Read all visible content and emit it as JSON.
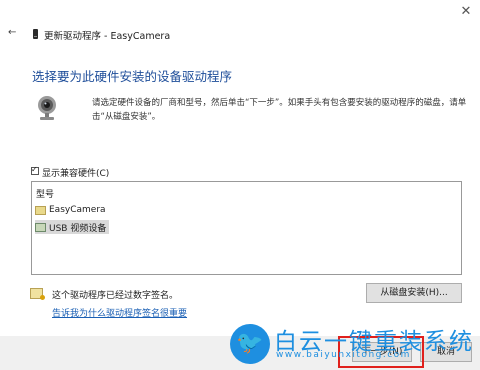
{
  "window": {
    "title": "更新驱动程序 - EasyCamera",
    "close_glyph": "✕",
    "back_glyph": "←"
  },
  "main": {
    "heading": "选择要为此硬件安装的设备驱动程序",
    "instruction": "请选定硬件设备的厂商和型号，然后单击“下一步”。如果手头有包含要安装的驱动程序的磁盘，请单击“从磁盘安装”。",
    "compat_label": "显示兼容硬件(C)",
    "compat_checked": true
  },
  "model_list": {
    "header": "型号",
    "items": [
      {
        "label": "EasyCamera",
        "selected": false
      },
      {
        "label": "USB 视频设备",
        "selected": true
      }
    ]
  },
  "signature": {
    "text": "这个驱动程序已经过数字签名。",
    "link": "告诉我为什么驱动程序签名很重要"
  },
  "buttons": {
    "have_disk": "从磁盘安装(H)...",
    "next": "下一步(N)",
    "cancel": "取消"
  },
  "watermark": {
    "brand": "白云一键重装系统",
    "url": "www.baiyunxitong.com"
  },
  "colors": {
    "heading": "#1f4e9a",
    "link": "#1a5fb4",
    "highlight": "#e0201c",
    "watermark": "#1e8fe0"
  }
}
